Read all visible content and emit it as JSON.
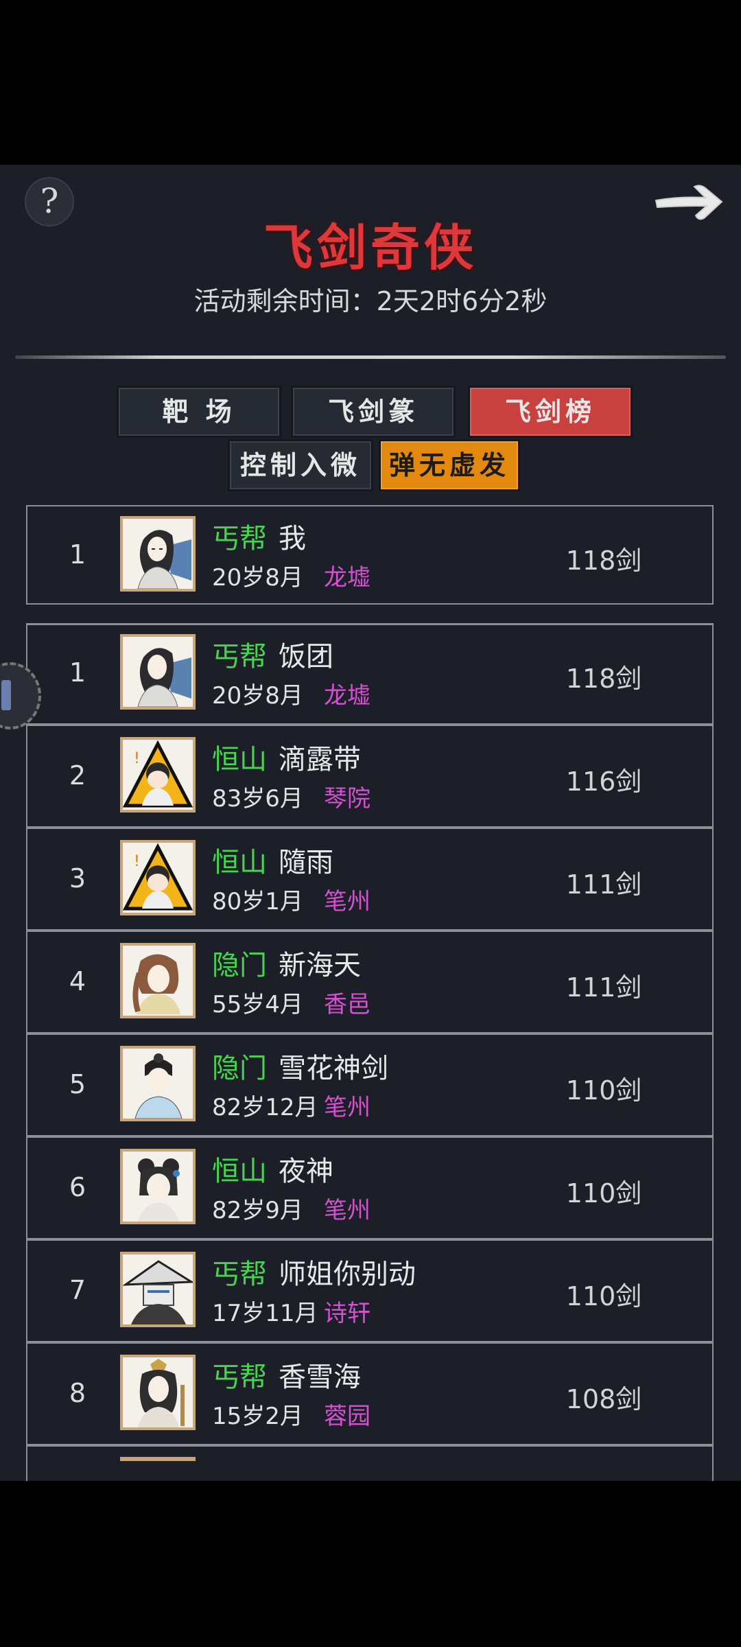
{
  "header": {
    "help_label": "?",
    "title": "飞剑奇侠",
    "timer": "活动剩余时间：2天2时6分2秒"
  },
  "tabs_row1": [
    {
      "label": "靶 场",
      "active": false
    },
    {
      "label": "飞剑篆",
      "active": false
    },
    {
      "label": "飞剑榜",
      "active": true
    }
  ],
  "tabs_row2": [
    {
      "label": "控制入微",
      "active": false
    },
    {
      "label": "弹无虚发",
      "active": true
    }
  ],
  "my_rank": {
    "rank": "1",
    "sect": "丐帮",
    "name": "我",
    "age": "20岁8月",
    "place": "龙墟",
    "score": "118剑",
    "avatar": "female-swordsman-fan-avatar"
  },
  "leaderboard": [
    {
      "rank": "1",
      "sect": "丐帮",
      "name": "饭团",
      "age": "20岁8月",
      "place": "龙墟",
      "score": "118剑",
      "avatar": "female-swordsman-fan-avatar"
    },
    {
      "rank": "2",
      "sect": "恒山",
      "name": "滴露带",
      "age": "83岁6月",
      "place": "琴院",
      "score": "116剑",
      "avatar": "warning-chibi-avatar"
    },
    {
      "rank": "3",
      "sect": "恒山",
      "name": "隨雨",
      "age": "80岁1月",
      "place": "笔州",
      "score": "111剑",
      "avatar": "warning-chibi-avatar"
    },
    {
      "rank": "4",
      "sect": "隐门",
      "name": "新海天",
      "age": "55岁4月",
      "place": "香邑",
      "score": "111剑",
      "avatar": "braided-lady-avatar"
    },
    {
      "rank": "5",
      "sect": "隐门",
      "name": "雪花神剑",
      "age": "82岁12月",
      "place": "笔州",
      "score": "110剑",
      "avatar": "young-scholar-avatar"
    },
    {
      "rank": "6",
      "sect": "恒山",
      "name": "夜神",
      "age": "82岁9月",
      "place": "笔州",
      "score": "110剑",
      "avatar": "hairpin-girl-avatar"
    },
    {
      "rank": "7",
      "sect": "丐帮",
      "name": "师姐你别动",
      "age": "17岁11月",
      "place": "诗轩",
      "score": "110剑",
      "avatar": "masked-hat-avatar"
    },
    {
      "rank": "8",
      "sect": "丐帮",
      "name": "香雪海",
      "age": "15岁2月",
      "place": "蓉园",
      "score": "108剑",
      "avatar": "crowned-lady-avatar"
    }
  ]
}
